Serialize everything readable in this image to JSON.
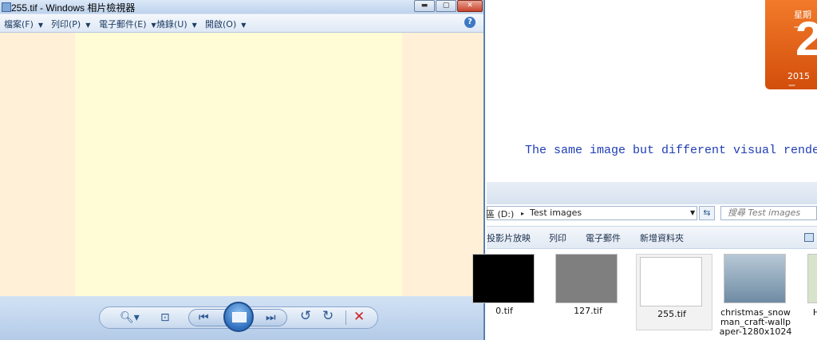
{
  "viewer": {
    "title": "255.tif - Windows 相片檢視器",
    "window_buttons": {
      "minimize": "▬",
      "maximize": "▢",
      "close": "✕"
    },
    "menu": [
      {
        "label": "檔案(F)"
      },
      {
        "label": "列印(P)"
      },
      {
        "label": "電子郵件(E)"
      },
      {
        "label": "燒錄(U)"
      },
      {
        "label": "開啟(O)"
      }
    ],
    "help_label": "?",
    "colors": {
      "canvas": "#fff0d7",
      "photo": "#fffcd6"
    },
    "controls": {
      "zoom": "🔍︎▾",
      "fit": "⊡",
      "previous": "⏮",
      "next": "⏭",
      "rotate_left": "↺",
      "rotate_right": "↻",
      "delete": "✕"
    }
  },
  "desktop": {
    "calendar": {
      "weekday": "星期一",
      "day": "2",
      "year": "2015 二"
    },
    "caption": "The same image but different visual rendering"
  },
  "explorer": {
    "address": {
      "drive": "區 (D:)",
      "separator": "▸",
      "folder": "Test images"
    },
    "search_placeholder": "搜尋 Test images",
    "commands": [
      "投影片放映",
      "列印",
      "電子郵件",
      "新增資料夾"
    ],
    "files": [
      {
        "name": "0.tif",
        "thumb_color": "#000000"
      },
      {
        "name": "127.tif",
        "thumb_color": "#7f7f7f"
      },
      {
        "name": "255.tif",
        "thumb_color": "#ffffff",
        "selected": true
      },
      {
        "name_lines": [
          "christmas_snow",
          "man_craft-wallp",
          "aper-1280x1024"
        ],
        "thumb_color": "#8fa7b8"
      },
      {
        "name": "H",
        "thumb_color": "#d8e3cc"
      }
    ]
  }
}
